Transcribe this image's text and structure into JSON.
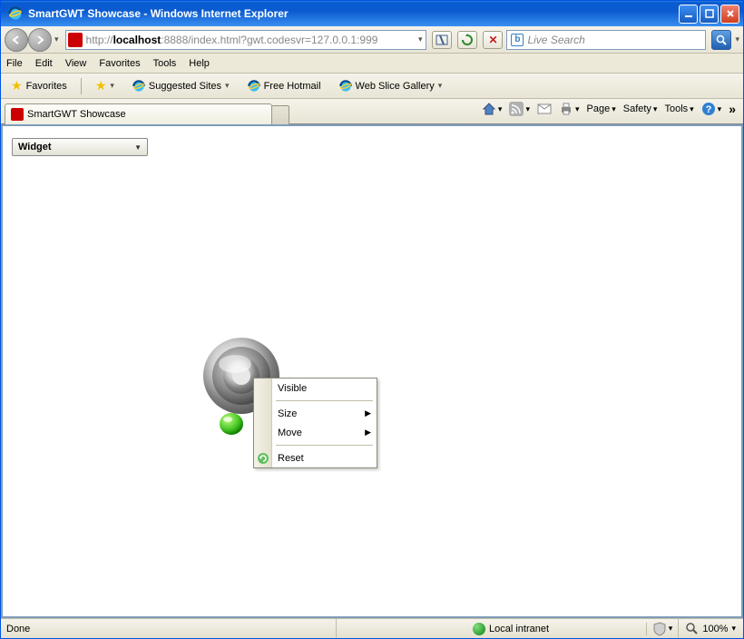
{
  "window": {
    "title": "SmartGWT Showcase - Windows Internet Explorer"
  },
  "nav": {
    "url_pre": "http://",
    "url_host": "localhost",
    "url_rest": ":8888/index.html?gwt.codesvr=127.0.0.1:999",
    "search_placeholder": "Live Search"
  },
  "menu": {
    "file": "File",
    "edit": "Edit",
    "view": "View",
    "favorites": "Favorites",
    "tools": "Tools",
    "help": "Help"
  },
  "favbar": {
    "favorites": "Favorites",
    "suggested": "Suggested Sites",
    "hotmail": "Free Hotmail",
    "webslice": "Web Slice Gallery"
  },
  "tab": {
    "title": "SmartGWT Showcase"
  },
  "tabtools": {
    "page": "Page",
    "safety": "Safety",
    "tools": "Tools"
  },
  "content": {
    "widget_label": "Widget"
  },
  "context_menu": {
    "visible": "Visible",
    "size": "Size",
    "move": "Move",
    "reset": "Reset"
  },
  "status": {
    "done": "Done",
    "zone": "Local intranet",
    "zoom": "100%"
  }
}
